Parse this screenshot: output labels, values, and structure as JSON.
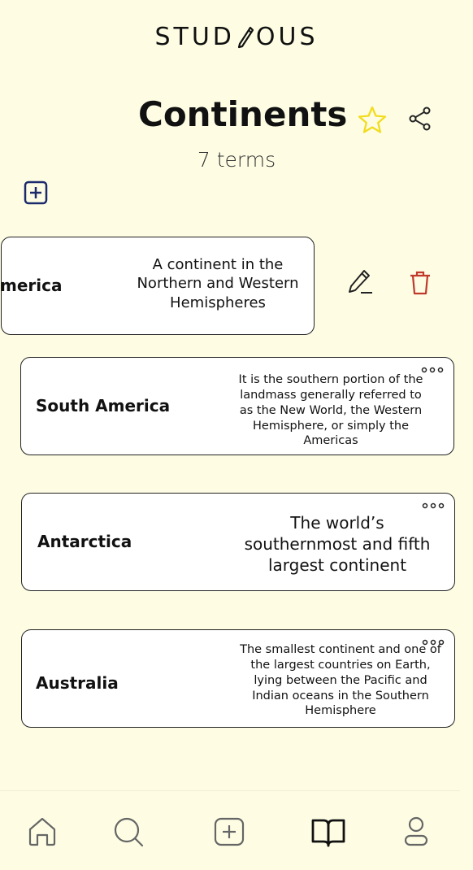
{
  "app": {
    "logo_left": "STUD",
    "logo_right": "OUS"
  },
  "set": {
    "title": "Continents",
    "count_label": "7 terms",
    "star_color": "#f7e63a"
  },
  "cards": [
    {
      "term": "merica",
      "definition": "A continent in the Northern and Western Hemispheres"
    },
    {
      "term": "South America",
      "definition": "It is the southern portion of the landmass generally referred to as the New World, the Western Hemisphere, or simply the Americas"
    },
    {
      "term": "Antarctica",
      "definition": "The world’s southernmost and fifth largest continent"
    },
    {
      "term": "Australia",
      "definition": "The smallest continent and one of the largest countries on Earth, lying between the Pacific and Indian oceans in the Southern Hemisphere"
    }
  ],
  "colors": {
    "background": "#fefde4",
    "delete": "#c0392b",
    "add_icon": "#1a2a6c"
  },
  "nav": {
    "items": [
      "home-icon",
      "search-icon",
      "add-icon",
      "library-icon",
      "profile-icon"
    ],
    "active": "library-icon"
  }
}
